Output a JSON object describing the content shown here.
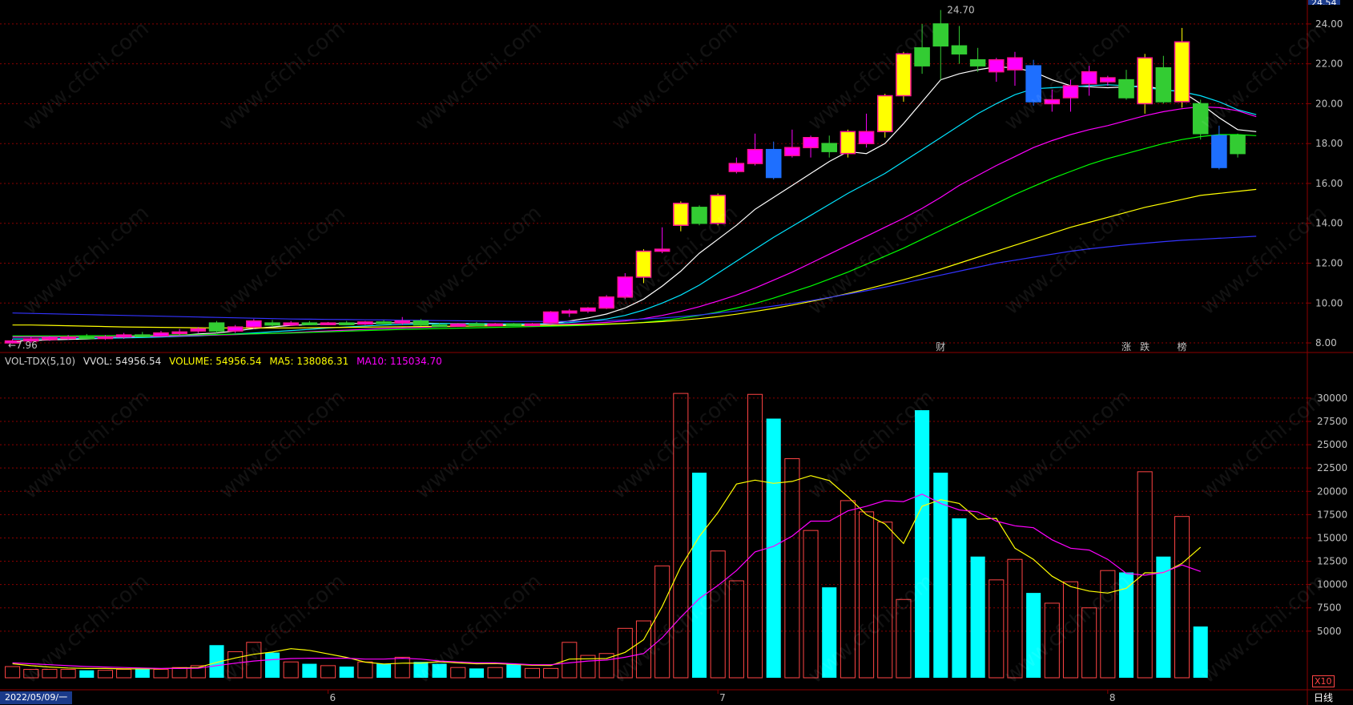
{
  "indicator_bar": {
    "name": "VOL-TDX(5,10)",
    "vvol_label": "VVOL: 54956.54",
    "volume_label": "VOLUME: 54956.54",
    "ma5_label": "MA5: 138086.31",
    "ma10_label": "MA10: 115034.70"
  },
  "corner": {
    "date_label": "2022/05/09/一",
    "period_label": "日线",
    "x10_label": "X10",
    "top_price": "24.54"
  },
  "watermark_text": "www.cfchi.com",
  "colors": {
    "up": "#ff4444",
    "down": "#00ffff",
    "ma5": "#ffffff",
    "ma10": "#00e5ff",
    "ma20": "#ff00ff",
    "ma30": "#00ff00",
    "ma60": "#ffff00",
    "ma120": "#3333ff",
    "vol_ma5": "#ffff00",
    "vol_ma10": "#ff00ff",
    "grid": "#8b0000",
    "axis": "#c0c0c0"
  },
  "chart_data": [
    {
      "type": "candlestick",
      "ylim": [
        7.6,
        24.8
      ],
      "y_ticks": [
        "8.00",
        "10.00",
        "12.00",
        "14.00",
        "16.00",
        "18.00",
        "20.00",
        "22.00",
        "24.00"
      ],
      "high_label": "24.70",
      "low_label": "7.96",
      "event_markers": [
        {
          "index": 50,
          "label": "财"
        },
        {
          "index": 60,
          "label": "涨"
        },
        {
          "index": 61,
          "label": "跌"
        },
        {
          "index": 63,
          "label": "榜"
        }
      ],
      "candles": [
        {
          "o": 8.0,
          "h": 8.2,
          "l": 7.96,
          "c": 8.1
        },
        {
          "o": 8.1,
          "h": 8.3,
          "l": 8.0,
          "c": 8.2
        },
        {
          "o": 8.2,
          "h": 8.35,
          "l": 8.1,
          "c": 8.25
        },
        {
          "o": 8.25,
          "h": 8.4,
          "l": 8.15,
          "c": 8.3
        },
        {
          "o": 8.3,
          "h": 8.45,
          "l": 8.2,
          "c": 8.25
        },
        {
          "o": 8.25,
          "h": 8.4,
          "l": 8.15,
          "c": 8.3
        },
        {
          "o": 8.3,
          "h": 8.5,
          "l": 8.2,
          "c": 8.4
        },
        {
          "o": 8.4,
          "h": 8.55,
          "l": 8.3,
          "c": 8.35
        },
        {
          "o": 8.35,
          "h": 8.6,
          "l": 8.3,
          "c": 8.5
        },
        {
          "o": 8.5,
          "h": 8.7,
          "l": 8.4,
          "c": 8.55
        },
        {
          "o": 8.6,
          "h": 8.8,
          "l": 8.5,
          "c": 8.7
        },
        {
          "o": 9.0,
          "h": 9.1,
          "l": 8.5,
          "c": 8.6
        },
        {
          "o": 8.6,
          "h": 8.9,
          "l": 8.5,
          "c": 8.8
        },
        {
          "o": 8.8,
          "h": 9.2,
          "l": 8.7,
          "c": 9.1
        },
        {
          "o": 9.0,
          "h": 9.15,
          "l": 8.8,
          "c": 8.9
        },
        {
          "o": 8.9,
          "h": 9.1,
          "l": 8.85,
          "c": 9.0
        },
        {
          "o": 9.0,
          "h": 9.1,
          "l": 8.9,
          "c": 8.95
        },
        {
          "o": 8.95,
          "h": 9.05,
          "l": 8.9,
          "c": 9.0
        },
        {
          "o": 9.0,
          "h": 9.1,
          "l": 8.9,
          "c": 8.95
        },
        {
          "o": 8.95,
          "h": 9.1,
          "l": 8.9,
          "c": 9.05
        },
        {
          "o": 9.05,
          "h": 9.15,
          "l": 8.95,
          "c": 9.0
        },
        {
          "o": 9.0,
          "h": 9.3,
          "l": 8.9,
          "c": 9.1
        },
        {
          "o": 9.1,
          "h": 9.2,
          "l": 8.85,
          "c": 8.9
        },
        {
          "o": 8.9,
          "h": 9.0,
          "l": 8.8,
          "c": 8.85
        },
        {
          "o": 8.85,
          "h": 9.0,
          "l": 8.8,
          "c": 8.95
        },
        {
          "o": 8.95,
          "h": 9.05,
          "l": 8.85,
          "c": 8.9
        },
        {
          "o": 8.9,
          "h": 9.0,
          "l": 8.85,
          "c": 8.95
        },
        {
          "o": 8.95,
          "h": 9.0,
          "l": 8.85,
          "c": 8.9
        },
        {
          "o": 8.9,
          "h": 9.0,
          "l": 8.85,
          "c": 8.95
        },
        {
          "o": 9.0,
          "h": 9.6,
          "l": 8.9,
          "c": 9.55
        },
        {
          "o": 9.5,
          "h": 9.7,
          "l": 9.3,
          "c": 9.6
        },
        {
          "o": 9.6,
          "h": 9.8,
          "l": 9.5,
          "c": 9.75
        },
        {
          "o": 9.75,
          "h": 10.4,
          "l": 9.7,
          "c": 10.3
        },
        {
          "o": 10.3,
          "h": 11.5,
          "l": 10.2,
          "c": 11.3
        },
        {
          "o": 11.3,
          "h": 12.7,
          "l": 11.0,
          "c": 12.6
        },
        {
          "o": 12.6,
          "h": 13.8,
          "l": 12.5,
          "c": 12.7
        },
        {
          "o": 13.9,
          "h": 15.1,
          "l": 13.6,
          "c": 15.0
        },
        {
          "o": 14.8,
          "h": 14.9,
          "l": 13.9,
          "c": 14.0
        },
        {
          "o": 14.0,
          "h": 15.5,
          "l": 13.9,
          "c": 15.4
        },
        {
          "o": 16.6,
          "h": 17.3,
          "l": 16.5,
          "c": 17.0
        },
        {
          "o": 17.0,
          "h": 18.5,
          "l": 16.9,
          "c": 17.7
        },
        {
          "o": 17.7,
          "h": 18.1,
          "l": 16.2,
          "c": 16.3
        },
        {
          "o": 17.4,
          "h": 18.7,
          "l": 17.3,
          "c": 17.8
        },
        {
          "o": 17.8,
          "h": 18.4,
          "l": 17.3,
          "c": 18.3
        },
        {
          "o": 18.0,
          "h": 18.4,
          "l": 17.3,
          "c": 17.6
        },
        {
          "o": 17.5,
          "h": 18.7,
          "l": 17.3,
          "c": 18.6
        },
        {
          "o": 18.0,
          "h": 19.5,
          "l": 17.8,
          "c": 18.6
        },
        {
          "o": 18.6,
          "h": 20.5,
          "l": 18.3,
          "c": 20.4
        },
        {
          "o": 20.4,
          "h": 22.6,
          "l": 20.1,
          "c": 22.5
        },
        {
          "o": 22.8,
          "h": 24.0,
          "l": 21.5,
          "c": 21.9
        },
        {
          "o": 24.0,
          "h": 24.7,
          "l": 21.2,
          "c": 22.9
        },
        {
          "o": 22.9,
          "h": 23.9,
          "l": 22.0,
          "c": 22.5
        },
        {
          "o": 22.2,
          "h": 22.8,
          "l": 21.6,
          "c": 21.9
        },
        {
          "o": 21.6,
          "h": 22.3,
          "l": 21.1,
          "c": 22.2
        },
        {
          "o": 21.7,
          "h": 22.6,
          "l": 20.9,
          "c": 22.3
        },
        {
          "o": 21.9,
          "h": 22.2,
          "l": 19.9,
          "c": 20.1
        },
        {
          "o": 20.0,
          "h": 20.7,
          "l": 19.6,
          "c": 20.2
        },
        {
          "o": 20.3,
          "h": 21.2,
          "l": 19.6,
          "c": 20.9
        },
        {
          "o": 21.0,
          "h": 21.9,
          "l": 20.4,
          "c": 21.6
        },
        {
          "o": 21.1,
          "h": 21.4,
          "l": 20.9,
          "c": 21.3
        },
        {
          "o": 21.2,
          "h": 21.7,
          "l": 20.2,
          "c": 20.3
        },
        {
          "o": 20.0,
          "h": 22.5,
          "l": 19.5,
          "c": 22.3
        },
        {
          "o": 21.8,
          "h": 22.4,
          "l": 20.0,
          "c": 20.1
        },
        {
          "o": 20.1,
          "h": 23.8,
          "l": 19.8,
          "c": 23.1
        },
        {
          "o": 20.0,
          "h": 20.2,
          "l": 18.2,
          "c": 18.5
        },
        {
          "o": 18.4,
          "h": 18.9,
          "l": 16.7,
          "c": 16.8
        },
        {
          "o": 18.4,
          "h": 18.5,
          "l": 17.3,
          "c": 17.5
        }
      ],
      "ma_lines": [
        {
          "name": "MA5",
          "values": [
            8.1,
            8.12,
            8.15,
            8.18,
            8.2,
            8.24,
            8.27,
            8.3,
            8.33,
            8.38,
            8.45,
            8.5,
            8.6,
            8.72,
            8.8,
            8.88,
            8.92,
            8.96,
            8.98,
            8.98,
            9.0,
            9.02,
            9.0,
            8.98,
            8.96,
            8.93,
            8.92,
            8.91,
            8.91,
            8.97,
            9.1,
            9.25,
            9.45,
            9.75,
            10.2,
            10.85,
            11.6,
            12.5,
            13.2,
            13.9,
            14.7,
            15.3,
            15.9,
            16.5,
            17.1,
            17.6,
            17.5,
            18.0,
            19.0,
            20.1,
            21.2,
            21.5,
            21.7,
            21.85,
            21.8,
            21.6,
            21.2,
            20.9,
            20.85,
            20.8,
            20.85,
            20.9,
            20.7,
            20.6,
            20.0,
            19.3,
            18.7,
            18.6
          ]
        },
        {
          "name": "MA10",
          "values": [
            8.2,
            8.2,
            8.21,
            8.22,
            8.23,
            8.24,
            8.25,
            8.27,
            8.3,
            8.33,
            8.36,
            8.4,
            8.45,
            8.5,
            8.56,
            8.62,
            8.68,
            8.75,
            8.8,
            8.85,
            8.9,
            8.93,
            8.95,
            8.97,
            8.97,
            8.97,
            8.96,
            8.95,
            8.95,
            8.97,
            9.02,
            9.1,
            9.2,
            9.38,
            9.65,
            10.0,
            10.4,
            10.9,
            11.5,
            12.1,
            12.7,
            13.3,
            13.85,
            14.4,
            14.95,
            15.5,
            16.0,
            16.5,
            17.1,
            17.7,
            18.3,
            18.9,
            19.5,
            20.0,
            20.45,
            20.75,
            20.8,
            20.85,
            20.9,
            20.95,
            20.9,
            20.8,
            20.7,
            20.6,
            20.4,
            20.1,
            19.7,
            19.45
          ]
        },
        {
          "name": "MA20",
          "values": [
            8.3,
            8.3,
            8.3,
            8.3,
            8.3,
            8.31,
            8.32,
            8.33,
            8.34,
            8.36,
            8.38,
            8.4,
            8.42,
            8.45,
            8.48,
            8.52,
            8.56,
            8.6,
            8.64,
            8.68,
            8.72,
            8.75,
            8.78,
            8.81,
            8.83,
            8.85,
            8.87,
            8.88,
            8.89,
            8.91,
            8.94,
            8.98,
            9.03,
            9.1,
            9.22,
            9.38,
            9.58,
            9.82,
            10.1,
            10.4,
            10.75,
            11.15,
            11.55,
            12.0,
            12.45,
            12.9,
            13.35,
            13.8,
            14.25,
            14.75,
            15.3,
            15.9,
            16.4,
            16.9,
            17.35,
            17.8,
            18.15,
            18.45,
            18.7,
            18.9,
            19.15,
            19.4,
            19.6,
            19.75,
            19.85,
            19.8,
            19.65,
            19.35
          ]
        },
        {
          "name": "MA30",
          "values": [
            8.35,
            8.35,
            8.35,
            8.35,
            8.36,
            8.36,
            8.37,
            8.38,
            8.39,
            8.4,
            8.41,
            8.42,
            8.44,
            8.46,
            8.48,
            8.5,
            8.53,
            8.56,
            8.59,
            8.62,
            8.65,
            8.68,
            8.7,
            8.72,
            8.74,
            8.76,
            8.78,
            8.8,
            8.82,
            8.84,
            8.86,
            8.89,
            8.93,
            8.97,
            9.03,
            9.12,
            9.24,
            9.38,
            9.55,
            9.75,
            9.98,
            10.25,
            10.55,
            10.85,
            11.2,
            11.55,
            11.95,
            12.35,
            12.75,
            13.2,
            13.65,
            14.1,
            14.55,
            15.0,
            15.45,
            15.85,
            16.25,
            16.6,
            16.95,
            17.25,
            17.5,
            17.75,
            18.0,
            18.2,
            18.35,
            18.45,
            18.45,
            18.4
          ]
        },
        {
          "name": "MA60",
          "values": [
            8.9,
            8.9,
            8.88,
            8.86,
            8.84,
            8.82,
            8.8,
            8.79,
            8.78,
            8.77,
            8.76,
            8.75,
            8.75,
            8.75,
            8.75,
            8.75,
            8.76,
            8.77,
            8.78,
            8.79,
            8.8,
            8.81,
            8.82,
            8.83,
            8.84,
            8.85,
            8.86,
            8.87,
            8.88,
            8.89,
            8.9,
            8.92,
            8.95,
            8.98,
            9.02,
            9.07,
            9.14,
            9.22,
            9.32,
            9.44,
            9.58,
            9.73,
            9.9,
            10.08,
            10.27,
            10.48,
            10.7,
            10.93,
            11.17,
            11.43,
            11.7,
            12.0,
            12.3,
            12.6,
            12.9,
            13.2,
            13.5,
            13.8,
            14.05,
            14.3,
            14.55,
            14.8,
            15.0,
            15.2,
            15.4,
            15.5,
            15.6,
            15.7
          ]
        },
        {
          "name": "MA120",
          "values": [
            9.5,
            9.48,
            9.46,
            9.44,
            9.42,
            9.4,
            9.38,
            9.36,
            9.34,
            9.32,
            9.3,
            9.28,
            9.26,
            9.24,
            9.22,
            9.2,
            9.19,
            9.18,
            9.17,
            9.16,
            9.15,
            9.14,
            9.13,
            9.12,
            9.11,
            9.1,
            9.09,
            9.08,
            9.08,
            9.08,
            9.08,
            9.1,
            9.12,
            9.15,
            9.2,
            9.25,
            9.32,
            9.4,
            9.5,
            9.6,
            9.72,
            9.85,
            9.98,
            10.12,
            10.28,
            10.45,
            10.62,
            10.8,
            11.0,
            11.2,
            11.4,
            11.6,
            11.8,
            12.0,
            12.15,
            12.3,
            12.45,
            12.6,
            12.72,
            12.82,
            12.92,
            13.0,
            13.08,
            13.15,
            13.2,
            13.25,
            13.3,
            13.35
          ]
        }
      ]
    },
    {
      "type": "bar",
      "title": "VOL-TDX(5,10)",
      "ylim": [
        0,
        33000
      ],
      "y_ticks": [
        "5000",
        "7500",
        "10000",
        "12500",
        "15000",
        "17500",
        "20000",
        "22500",
        "25000",
        "27500",
        "30000"
      ],
      "x_ticks": [
        {
          "index": 17,
          "label": "6"
        },
        {
          "index": 38,
          "label": "7"
        },
        {
          "index": 59,
          "label": "8"
        }
      ],
      "volumes": [
        1200,
        900,
        900,
        900,
        800,
        800,
        900,
        1000,
        900,
        1100,
        1300,
        3500,
        2800,
        3800,
        2700,
        1700,
        1500,
        1300,
        1200,
        1700,
        1500,
        2200,
        1700,
        1500,
        1100,
        1000,
        1100,
        1500,
        1000,
        1000,
        3800,
        2400,
        2600,
        5300,
        6100,
        12000,
        30500,
        22000,
        13600,
        10400,
        30400,
        27800,
        23500,
        15800,
        9700,
        19000,
        17800,
        16700,
        8400,
        28700,
        22000,
        17100,
        13000,
        10500,
        12700,
        9100,
        8000,
        10300,
        7500,
        11500,
        11300,
        22100,
        13000,
        17300,
        5500
      ],
      "vol_ma5": [
        1500,
        1300,
        1150,
        1050,
        1000,
        1000,
        950,
        950,
        980,
        1060,
        1100,
        1650,
        2120,
        2520,
        2760,
        3120,
        2940,
        2560,
        2180,
        1680,
        1480,
        1560,
        1580,
        1720,
        1600,
        1500,
        1520,
        1440,
        1340,
        1320,
        2000,
        2040,
        2060,
        2720,
        4080,
        7660,
        11900,
        15160,
        17720,
        20780,
        21200,
        20860,
        21060,
        21680,
        21160,
        19420,
        17500,
        16500,
        14400,
        18400,
        19100,
        18700,
        17000,
        17100,
        13900,
        12700,
        10900,
        9780,
        9300,
        9080,
        9600,
        11260,
        11260,
        12260,
        14000
      ],
      "vol_ma10": [
        1600,
        1500,
        1400,
        1300,
        1200,
        1150,
        1100,
        1050,
        1000,
        1000,
        1020,
        1300,
        1560,
        1800,
        1940,
        2060,
        2100,
        2100,
        2100,
        2000,
        2000,
        2100,
        2000,
        1800,
        1700,
        1600,
        1600,
        1500,
        1400,
        1400,
        1600,
        1800,
        1900,
        2200,
        2600,
        4300,
        6500,
        8500,
        9900,
        11500,
        13500,
        14100,
        15200,
        16800,
        16800,
        17900,
        18400,
        19000,
        18900,
        19700,
        18700,
        18000,
        17800,
        16800,
        16300,
        16100,
        14800,
        13900,
        13700,
        12700,
        11200,
        11000,
        11300,
        12100,
        11400
      ]
    }
  ]
}
